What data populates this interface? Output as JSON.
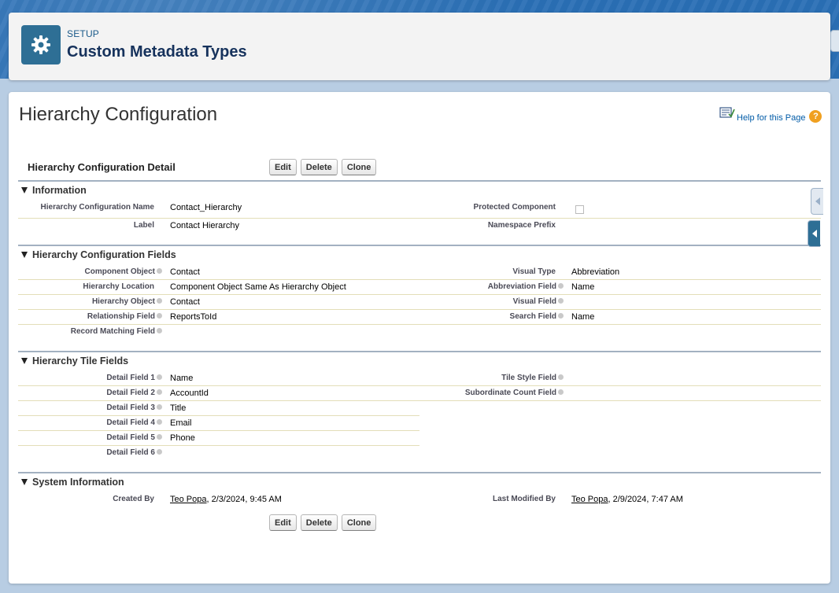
{
  "setup": {
    "eyebrow": "SETUP",
    "title": "Custom Metadata Types",
    "icon": "gear-icon"
  },
  "page": {
    "title": "Hierarchy Configuration",
    "help_label": "Help for this Page",
    "help_icon": "help-question-icon",
    "help_doc_icon": "help-document-icon"
  },
  "detail": {
    "title": "Hierarchy Configuration Detail",
    "buttons": {
      "edit": "Edit",
      "delete": "Delete",
      "clone": "Clone"
    }
  },
  "sections": {
    "information": {
      "title": "Information",
      "hierarchy_configuration_name_label": "Hierarchy Configuration Name",
      "hierarchy_configuration_name_value": "Contact_Hierarchy",
      "label_label": "Label",
      "label_value": "Contact Hierarchy",
      "protected_component_label": "Protected Component",
      "protected_component_checked": false,
      "namespace_prefix_label": "Namespace Prefix",
      "namespace_prefix_value": ""
    },
    "fields": {
      "title": "Hierarchy Configuration Fields",
      "component_object_label": "Component Object",
      "component_object_value": "Contact",
      "hierarchy_location_label": "Hierarchy Location",
      "hierarchy_location_value": "Component Object Same As Hierarchy Object",
      "hierarchy_object_label": "Hierarchy Object",
      "hierarchy_object_value": "Contact",
      "relationship_field_label": "Relationship Field",
      "relationship_field_value": "ReportsToId",
      "record_matching_field_label": "Record Matching Field",
      "record_matching_field_value": "",
      "visual_type_label": "Visual Type",
      "visual_type_value": "Abbreviation",
      "abbreviation_field_label": "Abbreviation Field",
      "abbreviation_field_value": "Name",
      "visual_field_label": "Visual Field",
      "visual_field_value": "",
      "search_field_label": "Search Field",
      "search_field_value": "Name"
    },
    "tiles": {
      "title": "Hierarchy Tile Fields",
      "detail_field_1_label": "Detail Field 1",
      "detail_field_1_value": "Name",
      "detail_field_2_label": "Detail Field 2",
      "detail_field_2_value": "AccountId",
      "detail_field_3_label": "Detail Field 3",
      "detail_field_3_value": "Title",
      "detail_field_4_label": "Detail Field 4",
      "detail_field_4_value": "Email",
      "detail_field_5_label": "Detail Field 5",
      "detail_field_5_value": "Phone",
      "detail_field_6_label": "Detail Field 6",
      "detail_field_6_value": "",
      "tile_style_field_label": "Tile Style Field",
      "tile_style_field_value": "",
      "subordinate_count_field_label": "Subordinate Count Field",
      "subordinate_count_field_value": ""
    },
    "system": {
      "title": "System Information",
      "created_by_label": "Created By",
      "created_by_user": "Teo Popa",
      "created_by_date": ", 2/3/2024, 9:45 AM",
      "last_modified_by_label": "Last Modified By",
      "last_modified_by_user": "Teo Popa",
      "last_modified_by_date": ", 2/9/2024, 7:47 AM"
    }
  },
  "colors": {
    "brand_header_bg": "#2a6fb5",
    "setup_icon_bg": "#2e6f95",
    "title_navy": "#16325c",
    "link_blue": "#015ba7",
    "help_orange": "#f0a020"
  }
}
